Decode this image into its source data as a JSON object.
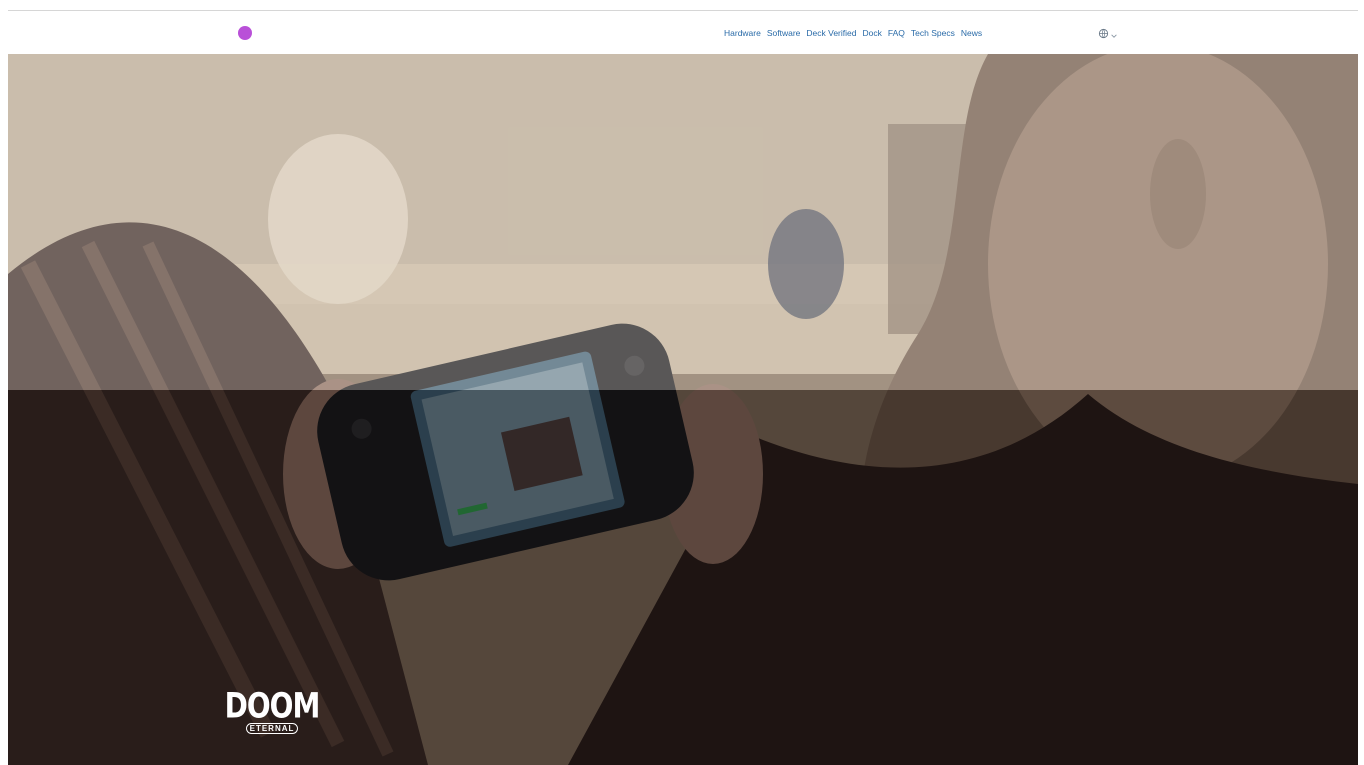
{
  "nav": {
    "links": [
      "Hardware",
      "Software",
      "Deck Verified",
      "Dock",
      "FAQ",
      "Tech Specs",
      "News"
    ],
    "language_icon": "globe-icon",
    "language_caret": "chevron-down-icon"
  },
  "brand": {
    "logo_color": "#b950d8",
    "link_color": "#2a6ba8"
  },
  "hero": {
    "featured_game_logo": {
      "line1": "DOOM",
      "line2": "ETERNAL"
    }
  }
}
